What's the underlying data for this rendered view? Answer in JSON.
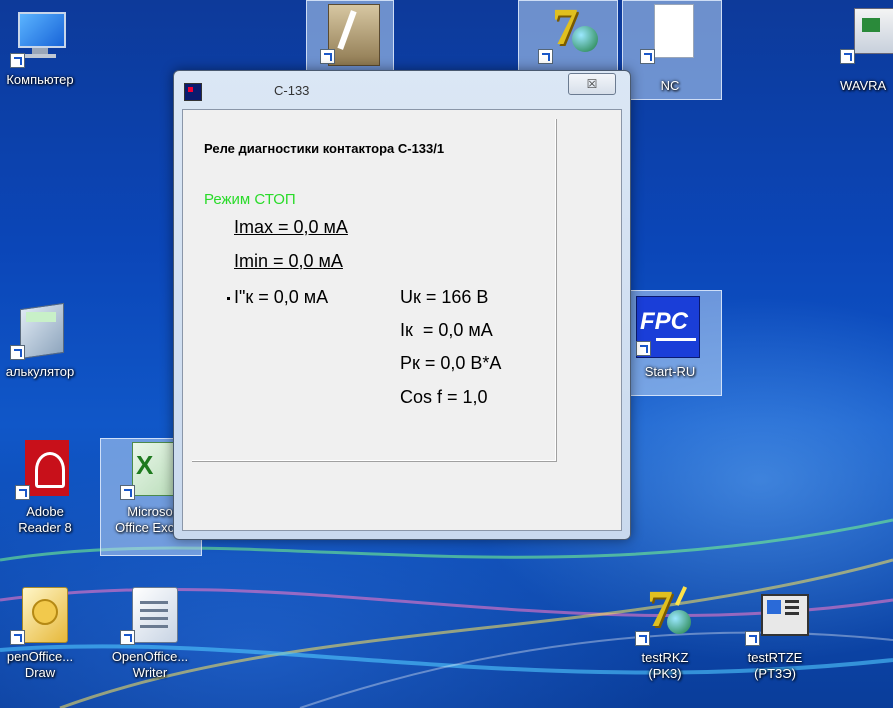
{
  "desktop": {
    "icons": [
      {
        "name": "computer",
        "label": "Компьютер"
      },
      {
        "name": "calculator",
        "label": "алькулятор"
      },
      {
        "name": "adobe-reader",
        "label": "Adobe\nReader 8"
      },
      {
        "name": "excel",
        "label": "Microso\nOffice Exc..."
      },
      {
        "name": "oo-draw",
        "label": "penOffice...\nDraw"
      },
      {
        "name": "oo-writer",
        "label": "OpenOffice...\nWriter"
      },
      {
        "name": "nc",
        "label": "NC"
      },
      {
        "name": "wavra",
        "label": "WAVRA"
      },
      {
        "name": "start-ru",
        "label": "Start-RU"
      },
      {
        "name": "testrkz",
        "label": "testRKZ\n(PK3)"
      },
      {
        "name": "testrtze",
        "label": "testRTZE\n(PT3Э)"
      }
    ],
    "fpc_logo_text": "FPC"
  },
  "window": {
    "title": "C-133",
    "close_glyph": "☒"
  },
  "panel": {
    "title": "Реле диагностики контактора С-133/1",
    "mode": "Режим СТОП",
    "imax": "Imax = 0,0 мА",
    "imin": "Imin = 0,0 мА",
    "i_prime": "I\"к = 0,0 мА",
    "uk": "Uк = 166 В",
    "ik": "Iк  = 0,0 мА",
    "pk": "Pк = 0,0 В*А",
    "cosf": "Cos f = 1,0"
  },
  "colors": {
    "mode_status": "#2adb2a",
    "desktop_bg": "#0b46b8"
  }
}
